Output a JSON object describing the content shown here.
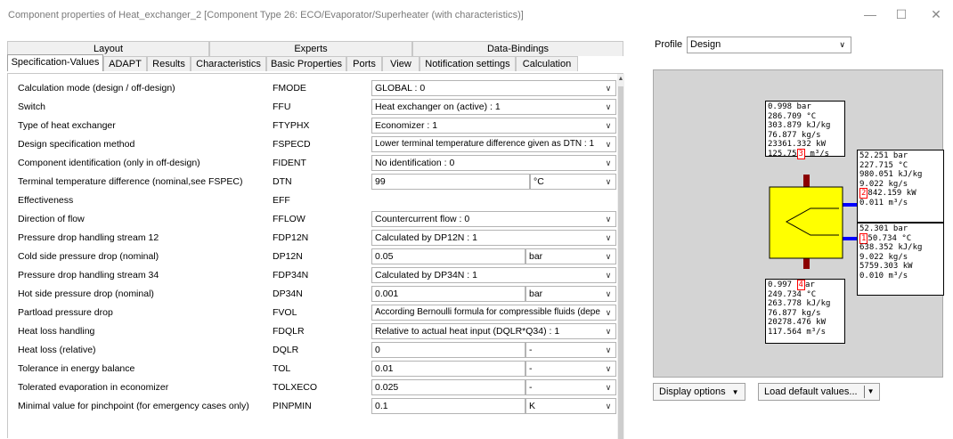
{
  "window": {
    "title": "Component properties of Heat_exchanger_2   [Component Type 26: ECO/Evaporator/Superheater (with characteristics)]",
    "minimize_glyph": "—",
    "maximize_glyph": "☐",
    "close_glyph": "✕"
  },
  "tabs_row1": [
    {
      "label": "Layout"
    },
    {
      "label": "Experts"
    },
    {
      "label": "Data-Bindings"
    }
  ],
  "tabs_row2": [
    {
      "label": "Specification-Values"
    },
    {
      "label": "ADAPT"
    },
    {
      "label": "Results"
    },
    {
      "label": "Characteristics"
    },
    {
      "label": "Basic Properties"
    },
    {
      "label": "Ports"
    },
    {
      "label": "View"
    },
    {
      "label": "Notification settings"
    },
    {
      "label": "Calculation"
    }
  ],
  "params": [
    {
      "label": "Calculation mode (design / off-design)",
      "code": "FMODE",
      "value": "GLOBAL : 0"
    },
    {
      "label": "Switch",
      "code": "FFU",
      "value": "Heat exchanger on (active) : 1"
    },
    {
      "label": "Type of heat exchanger",
      "code": "FTYPHX",
      "value": "Economizer : 1"
    },
    {
      "label": "Design specification method",
      "code": "FSPECD",
      "value": "Lower terminal temperature difference given as DTN : 1"
    },
    {
      "label": "Component identification (only in off-design)",
      "code": "FIDENT",
      "value": "No identification : 0"
    },
    {
      "label": "Terminal temperature difference (nominal,see FSPEC)",
      "code": "DTN",
      "value": "99",
      "unit": "°C"
    },
    {
      "label": "Effectiveness",
      "code": "EFF"
    },
    {
      "label": "Direction of flow",
      "code": "FFLOW",
      "value": "Countercurrent flow : 0"
    },
    {
      "label": "Pressure drop handling stream 12",
      "code": "FDP12N",
      "value": "Calculated by DP12N : 1"
    },
    {
      "label": "Cold side pressure drop (nominal)",
      "code": "DP12N",
      "value": "0.05",
      "unit": "bar"
    },
    {
      "label": "Pressure drop handling stream 34",
      "code": "FDP34N",
      "value": "Calculated by DP34N : 1"
    },
    {
      "label": "Hot side pressure drop (nominal)",
      "code": "DP34N",
      "value": "0.001",
      "unit": "bar"
    },
    {
      "label": "Partload pressure drop",
      "code": "FVOL",
      "value": "According Bernoulli formula for compressible fluids (depe"
    },
    {
      "label": "Heat loss handling",
      "code": "FDQLR",
      "value": "Relative to actual heat input (DQLR*Q34) : 1"
    },
    {
      "label": "Heat loss (relative)",
      "code": "DQLR",
      "value": "0",
      "unit": "-"
    },
    {
      "label": "Tolerance in energy balance",
      "code": "TOL",
      "value": "0.01",
      "unit": "-"
    },
    {
      "label": "Tolerated evaporation in economizer",
      "code": "TOLXECO",
      "value": "0.025",
      "unit": "-"
    },
    {
      "label": "Minimal value for pinchpoint (for emergency cases only)",
      "code": "PINPMIN",
      "value": "0.1",
      "unit": "K"
    }
  ],
  "profile": {
    "label": "Profile",
    "value": "Design"
  },
  "streams": {
    "top": {
      "port": "3",
      "lines": [
        "0.998 bar",
        "286.709 °C",
        "303.879 kJ/kg",
        "76.877 kg/s",
        "23361.332 kW"
      ],
      "last_pre": "125.75",
      "last_post": " m³/s"
    },
    "right_top": {
      "port": "2",
      "lines": [
        "52.251 bar",
        "227.715 °C",
        "980.051 kJ/kg",
        "9.022 kg/s"
      ],
      "mid_post": "842.159 kW",
      "last": "0.011 m³/s"
    },
    "right_bottom": {
      "port": "1",
      "first": "52.301 bar",
      "mid_post": "50.734 °C",
      "lines": [
        "638.352 kJ/kg",
        "9.022 kg/s",
        "5759.303 kW",
        "0.010 m³/s"
      ]
    },
    "bottom": {
      "port": "4",
      "first_pre": "0.997 ",
      "first_post": "ar",
      "lines": [
        "249.734 °C",
        "263.778 kJ/kg",
        "76.877 kg/s",
        "20278.476 kW",
        "117.564 m³/s"
      ]
    }
  },
  "buttons": {
    "display_options": "Display options",
    "load_defaults": "Load default values..."
  },
  "colors": {
    "hx_fill": "#ffff00",
    "hot_stream": "#8b0000",
    "cold_stream": "#0000ff",
    "diagram_bg": "#d4d4d4"
  }
}
